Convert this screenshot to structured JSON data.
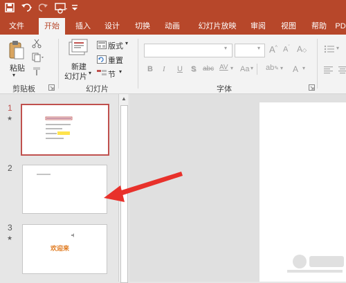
{
  "quick_access": {
    "save_icon": "save-icon",
    "undo_icon": "undo-icon",
    "redo_icon": "redo-icon"
  },
  "tabs": [
    "文件",
    "开始",
    "插入",
    "设计",
    "切换",
    "动画",
    "幻灯片放映",
    "审阅",
    "视图",
    "帮助",
    "PD"
  ],
  "ribbon": {
    "clipboard": {
      "paste_label": "粘贴",
      "group_label": "剪贴板"
    },
    "slides": {
      "new_slide_line1": "新建",
      "new_slide_line2": "幻灯片",
      "layout_label": "版式",
      "reset_label": "重置",
      "section_label": "节",
      "group_label": "幻灯片"
    },
    "font": {
      "group_label": "字体",
      "bold": "B",
      "italic": "I",
      "underline": "U",
      "shadow": "S",
      "strike": "abc",
      "spacing": "AV",
      "case": "Aa"
    }
  },
  "slides": [
    {
      "number": "1",
      "star": "★"
    },
    {
      "number": "2",
      "star": ""
    },
    {
      "number": "3",
      "star": "★",
      "text": "欢迎来"
    }
  ],
  "colors": {
    "accent": "#b7472a",
    "selection": "#c0504d",
    "arrow": "#e8312b"
  }
}
